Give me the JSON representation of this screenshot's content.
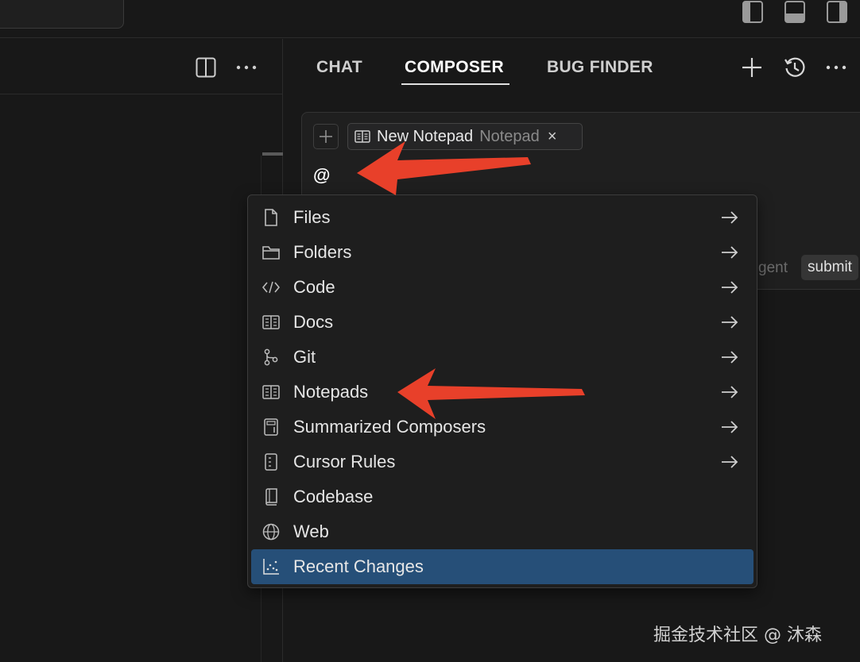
{
  "right_panel": {
    "tabs": [
      {
        "label": "CHAT",
        "active": false
      },
      {
        "label": "COMPOSER",
        "active": true
      },
      {
        "label": "BUG FINDER",
        "active": false
      }
    ]
  },
  "composer": {
    "context_chip": {
      "label": "New Notepad",
      "kind": "Notepad",
      "close": "×"
    },
    "input_text": "@",
    "mode_text": "gent",
    "submit_label": "submit"
  },
  "mention_menu": {
    "items": [
      {
        "label": "Files",
        "icon": "file-icon",
        "has_submenu": true
      },
      {
        "label": "Folders",
        "icon": "folder-icon",
        "has_submenu": true
      },
      {
        "label": "Code",
        "icon": "code-icon",
        "has_submenu": true
      },
      {
        "label": "Docs",
        "icon": "book-icon",
        "has_submenu": true
      },
      {
        "label": "Git",
        "icon": "git-branch-icon",
        "has_submenu": true
      },
      {
        "label": "Notepads",
        "icon": "notepad-icon",
        "has_submenu": true
      },
      {
        "label": "Summarized Composers",
        "icon": "composer-icon",
        "has_submenu": true
      },
      {
        "label": "Cursor Rules",
        "icon": "rules-icon",
        "has_submenu": true
      },
      {
        "label": "Codebase",
        "icon": "codebase-icon",
        "has_submenu": false
      },
      {
        "label": "Web",
        "icon": "globe-icon",
        "has_submenu": false
      },
      {
        "label": "Recent Changes",
        "icon": "recent-changes-icon",
        "has_submenu": false,
        "selected": true
      }
    ]
  },
  "colors": {
    "background": "#181818",
    "selection": "#264f78",
    "annotation_arrow": "#e8402a"
  },
  "watermark": "掘金技术社区 @ 沐森"
}
